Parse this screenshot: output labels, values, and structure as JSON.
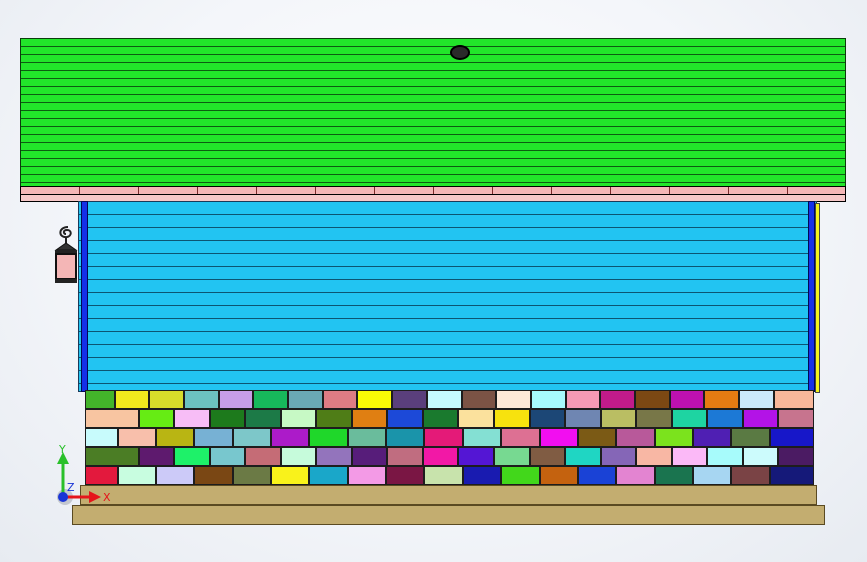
{
  "scene": {
    "colors": {
      "background": "#f4f6fa",
      "roof": "#22e62a",
      "roof_lines": "#0d5d12",
      "roof_band": "#f4b6b6",
      "siding": "#22c4f2",
      "corner_trim": "#1530e8",
      "right_trim": "#f2f21a",
      "footing": "#c3ad70",
      "lantern_glass": "#f4b6b6"
    },
    "icons": {
      "roof_vent": "circular-vent-icon",
      "wall_lantern": "wall-lantern-icon"
    }
  },
  "brick_rows": [
    [
      "#43b42a",
      "#f1e91d",
      "#d8dc2a",
      "#6cc2c0",
      "#c79ee8",
      "#17b85b",
      "#6aa9b5",
      "#df7c84",
      "#f9fb06",
      "#5a3f7c",
      "#c6fbff",
      "#7b5345",
      "#fde9d7",
      "#a7fbfc",
      "#f59ab5",
      "#c11b8a",
      "#7b4813",
      "#bd11b0",
      "#e57b12",
      "#cce9fb",
      "#f8b79a"
    ],
    [
      "#f8c5a1",
      "#66ec14",
      "#f7bdf6",
      "#1d7a1c",
      "#1c7a47",
      "#c7f9c5",
      "#4f7d17",
      "#e07f12",
      "#1c49d8",
      "#1a7a2e",
      "#fbe19d",
      "#f7e20e",
      "#1c4776",
      "#6f86b2",
      "#babe63",
      "#787748",
      "#1ed4a2",
      "#1c79d6",
      "#b313e7",
      "#c7748e"
    ],
    [
      "#c8fbfc",
      "#f8bfab",
      "#b9b513",
      "#77b1d4",
      "#7dc7c9",
      "#ac1bc9",
      "#1fd72a",
      "#6abc9c",
      "#1a94aa",
      "#e41a78",
      "#84e0d3",
      "#dd7093",
      "#f20ef0",
      "#7b5a15",
      "#b8599a",
      "#7be31d",
      "#4f1fb3",
      "#5a7a43",
      "#1717c9"
    ],
    [
      "#4b7d25",
      "#5e1a6e",
      "#1ef169",
      "#78c7ce",
      "#c56c76",
      "#c6fbdb",
      "#9374bc",
      "#571d7a",
      "#c06d80",
      "#f218a6",
      "#5416d4",
      "#77d991",
      "#805c43",
      "#1fd6c3",
      "#8566b7",
      "#f8b7a4",
      "#fbb9f7",
      "#a7fbfb",
      "#ccfbfc",
      "#4b1b63"
    ],
    [
      "#e3193d",
      "#c8fde0",
      "#cccaf8",
      "#7a4714",
      "#6b7a45",
      "#f9f21b",
      "#1aa7c9",
      "#f39ae6",
      "#7a1644",
      "#c8e3ac",
      "#191bb0",
      "#42d71b",
      "#c4620f",
      "#1a42d6",
      "#e384d1",
      "#1a744f",
      "#a7d6f2",
      "#7a4345",
      "#151979"
    ]
  ],
  "axes_triad": {
    "x_label": "X",
    "y_label": "Y",
    "z_label": "Z",
    "x_color": "#e5151b",
    "y_color": "#29c02a",
    "z_color": "#1a35d6"
  }
}
